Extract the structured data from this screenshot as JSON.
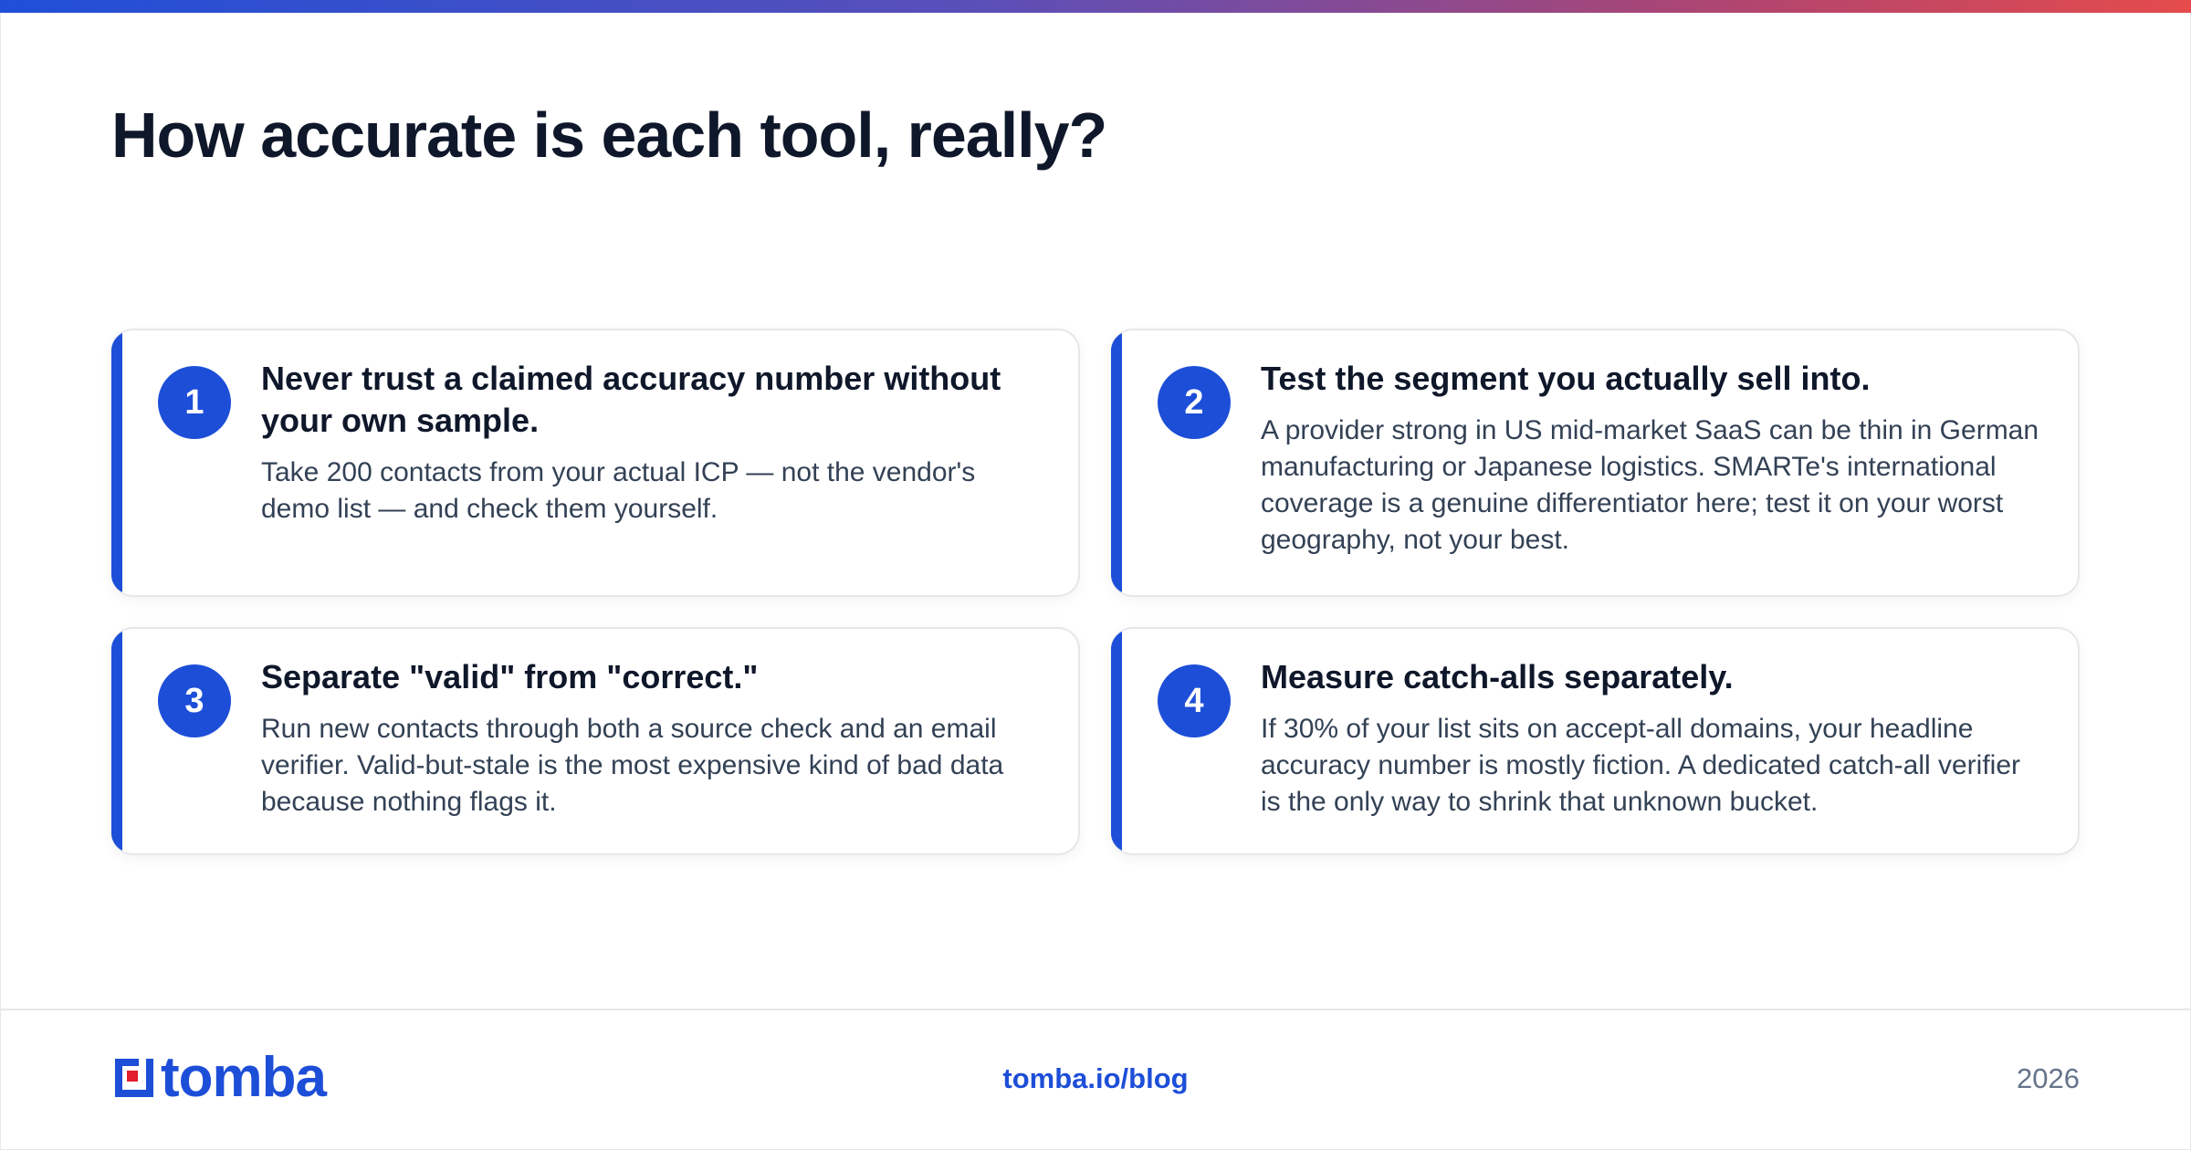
{
  "title": "How accurate is each tool, really?",
  "cards": [
    {
      "number": "1",
      "title": "Never trust a claimed accuracy number without your own sample.",
      "text": "Take 200 contacts from your actual ICP — not the vendor's demo list — and check them yourself."
    },
    {
      "number": "2",
      "title": "Test the segment you actually sell into.",
      "text": "A provider strong in US mid-market SaaS can be thin in German manufacturing or Japanese logistics. SMARTe's international coverage is a genuine differentiator here; test it on your worst geography, not your best."
    },
    {
      "number": "3",
      "title": "Separate \"valid\" from \"correct.\"",
      "text": "Run new contacts through both a source check and an email verifier. Valid-but-stale is the most expensive kind of bad data because nothing flags it."
    },
    {
      "number": "4",
      "title": "Measure catch-alls separately.",
      "text": "If 30% of your list sits on accept-all domains, your headline accuracy number is mostly fiction. A dedicated catch-all verifier is the only way to shrink that unknown bucket."
    }
  ],
  "footer": {
    "logo_text": "tomba",
    "link": "tomba.io/blog",
    "year": "2026"
  },
  "colors": {
    "accent": "#1d4ed8",
    "title": "#0f172a",
    "body_text": "#334155",
    "muted": "#64748b",
    "gradient_start": "#1f4fd8",
    "gradient_end": "#e54b4b",
    "logo_red": "#e11d2e"
  },
  "icons": {
    "logo_mark": "tomba-logo-icon"
  }
}
